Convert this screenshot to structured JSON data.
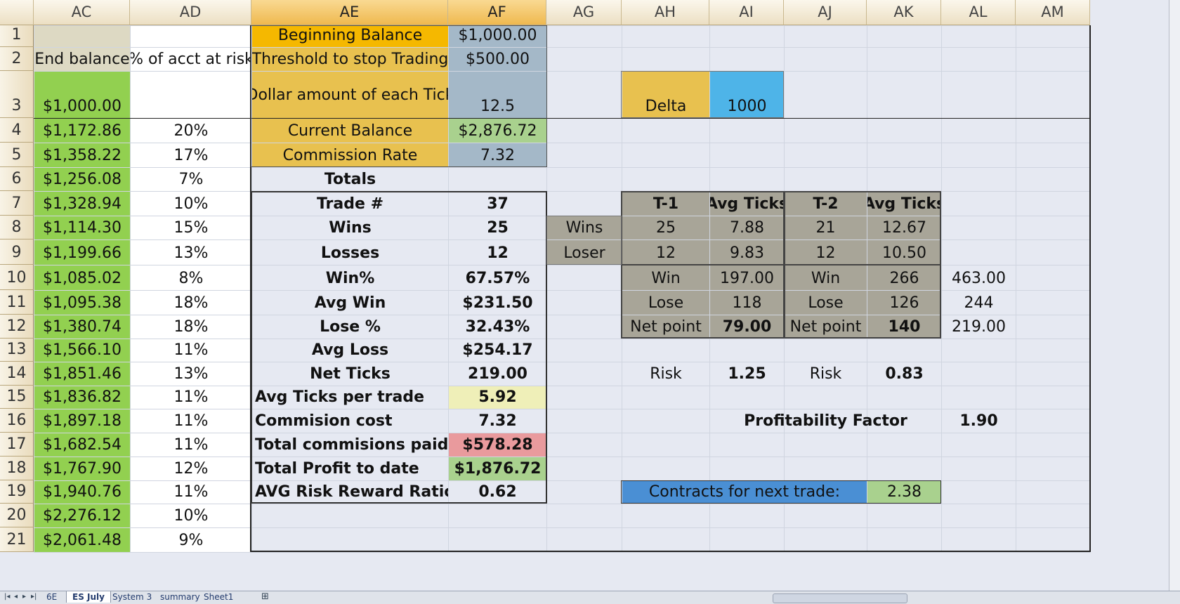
{
  "columns": [
    {
      "key": "AC",
      "selected": false
    },
    {
      "key": "AD",
      "selected": false
    },
    {
      "key": "AE",
      "selected": true
    },
    {
      "key": "AF",
      "selected": true
    },
    {
      "key": "AG",
      "selected": false
    },
    {
      "key": "AH",
      "selected": false
    },
    {
      "key": "AI",
      "selected": false
    },
    {
      "key": "AJ",
      "selected": false
    },
    {
      "key": "AK",
      "selected": false
    },
    {
      "key": "AL",
      "selected": false
    },
    {
      "key": "AM",
      "selected": false
    }
  ],
  "rows": [
    "1",
    "2",
    "3",
    "4",
    "5",
    "6",
    "7",
    "8",
    "9",
    "10",
    "11",
    "12",
    "13",
    "14",
    "15",
    "16",
    "17",
    "18",
    "19",
    "20",
    "21"
  ],
  "cells": {
    "AC2": "End balance",
    "AD2": "% of acct at risk",
    "AC3": "$1,000.00",
    "AC4": "$1,172.86",
    "AC5": "$1,358.22",
    "AC6": "$1,256.08",
    "AC7": "$1,328.94",
    "AC8": "$1,114.30",
    "AC9": "$1,199.66",
    "AC10": "$1,085.02",
    "AC11": "$1,095.38",
    "AC12": "$1,380.74",
    "AC13": "$1,566.10",
    "AC14": "$1,851.46",
    "AC15": "$1,836.82",
    "AC16": "$1,897.18",
    "AC17": "$1,682.54",
    "AC18": "$1,767.90",
    "AC19": "$1,940.76",
    "AC20": "$2,276.12",
    "AC21": "$2,061.48",
    "AD4": "20%",
    "AD5": "17%",
    "AD6": "7%",
    "AD7": "10%",
    "AD8": "15%",
    "AD9": "13%",
    "AD10": "8%",
    "AD11": "18%",
    "AD12": "18%",
    "AD13": "11%",
    "AD14": "13%",
    "AD15": "11%",
    "AD16": "11%",
    "AD17": "11%",
    "AD18": "12%",
    "AD19": "11%",
    "AD20": "10%",
    "AD21": "9%",
    "AE1": "Beginning Balance",
    "AF1": "$1,000.00",
    "AE2": "Threshold to stop Trading",
    "AF2": "$500.00",
    "AE3": "Dollar amount of each Tick",
    "AF3": "12.5",
    "AE4": "Current Balance",
    "AF4": "$2,876.72",
    "AE5": "Commission Rate",
    "AF5": "7.32",
    "AE6": "Totals",
    "AE7": "Trade #",
    "AF7": "37",
    "AE8": "Wins",
    "AF8": "25",
    "AE9": "Losses",
    "AF9": "12",
    "AE10": "Win%",
    "AF10": "67.57%",
    "AE11": "Avg Win",
    "AF11": "$231.50",
    "AE12": "Lose %",
    "AF12": "32.43%",
    "AE13": "Avg Loss",
    "AF13": "$254.17",
    "AE14": "Net Ticks",
    "AF14": "219.00",
    "AE15": "Avg Ticks per trade",
    "AF15": "5.92",
    "AE16": "Commision cost",
    "AF16": "7.32",
    "AE17": "Total commisions paid",
    "AF17": "$578.28",
    "AE18": "Total Profit to date",
    "AF18": "$1,876.72",
    "AE19": "AVG Risk Reward Ratio",
    "AF19": "0.62",
    "AH3": "Delta",
    "AI3": "1000",
    "AH7": "T-1",
    "AI7": "Avg Ticks",
    "AJ7": "T-2",
    "AK7": "Avg Ticks",
    "AG8": "Wins",
    "AH8": "25",
    "AI8": "7.88",
    "AJ8": "21",
    "AK8": "12.67",
    "AG9": "Loser",
    "AH9": "12",
    "AI9": "9.83",
    "AJ9": "12",
    "AK9": "10.50",
    "AH10": "Win",
    "AI10": "197.00",
    "AJ10": "Win",
    "AK10": "266",
    "AL10": "463.00",
    "AH11": "Lose",
    "AI11": "118",
    "AJ11": "Lose",
    "AK11": "126",
    "AL11": "244",
    "AH12": "Net point",
    "AI12": "79.00",
    "AJ12": "Net point",
    "AK12": "140",
    "AL12": "219.00",
    "AH14": "Risk",
    "AI14": "1.25",
    "AJ14": "Risk",
    "AK14": "0.83",
    "AJ16": "Profitability Factor",
    "AL16": "1.90",
    "AH19": "Contracts for next trade:",
    "AK19": "2.38"
  },
  "colors": {
    "green_fill": "#92d050",
    "orange_fill": "#f5b800",
    "gold_fill": "#e8c14f",
    "steel_fill": "#a4b8c8",
    "light_green": "#a9d18e",
    "pale_yellow": "#efefb8",
    "pink": "#e99a9d",
    "sky_blue": "#4eb4e8",
    "blue_fill": "#4a8fd4",
    "taupe": "#a8a598",
    "khaki": "#ddd9c3"
  },
  "sheet_tabs": [
    "6E",
    "ES July",
    "System 3",
    "summary",
    "Sheet1"
  ],
  "active_tab": "ES July"
}
